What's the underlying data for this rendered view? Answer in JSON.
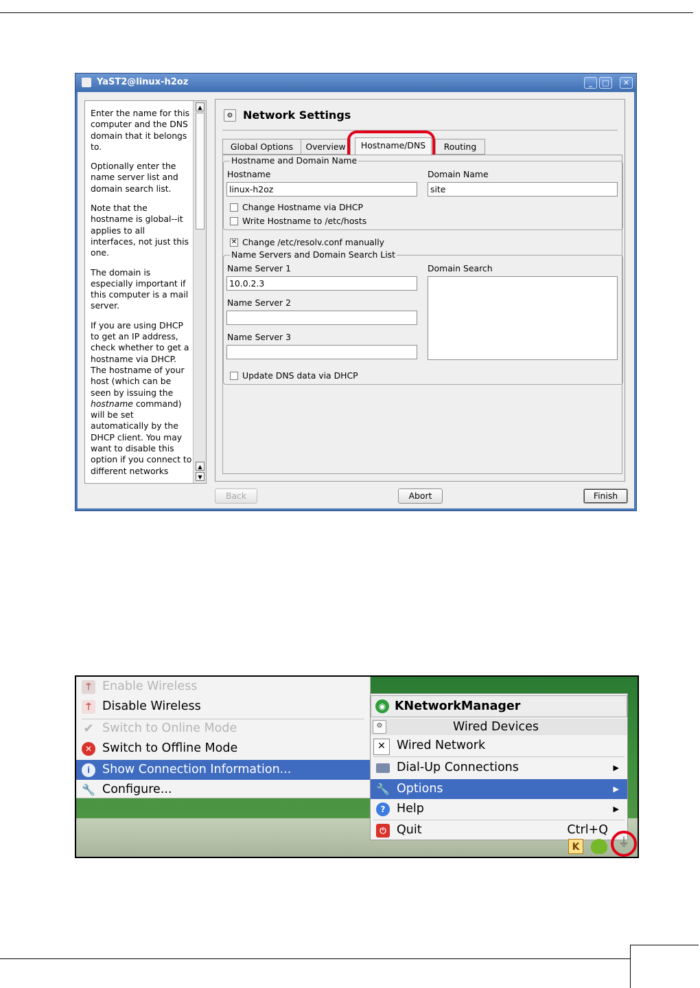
{
  "yast": {
    "title": "YaST2@linux-h2oz",
    "help_paragraphs": [
      "Enter the name for this computer and the DNS domain that it belongs to.",
      "Optionally enter the name server list and domain search list.",
      "Note that the hostname is global--it applies to all interfaces, not just this one.",
      "The domain is especially important if this computer is a mail server."
    ],
    "help_dhcp": {
      "before": "If you are using DHCP to get an IP address, check whether to get a hostname via DHCP. The hostname of your host (which can be seen by issuing the ",
      "em": "hostname",
      "after": " command) will be set automatically by the DHCP client. You may want to disable this option if you connect to different networks"
    },
    "page_title": "Network Settings",
    "tabs": [
      "Global Options",
      "Overview",
      "Hostname/DNS",
      "Routing"
    ],
    "group_hostname": "Hostname and Domain Name",
    "hostname_label": "Hostname",
    "hostname_value": "linux-h2oz",
    "domain_label": "Domain Name",
    "domain_value": "site",
    "cb_change_hostname": "Change Hostname via DHCP",
    "cb_write_hostname": "Write Hostname to /etc/hosts",
    "cb_resolv": "Change /etc/resolv.conf manually",
    "group_ns": "Name Servers and Domain Search List",
    "ns1_label": "Name Server 1",
    "ns1_value": "10.0.2.3",
    "ns2_label": "Name Server 2",
    "ns3_label": "Name Server 3",
    "domain_search_label": "Domain Search",
    "cb_update_dns": "Update DNS data via DHCP",
    "btn_back": "Back",
    "btn_abort": "Abort",
    "btn_finish": "Finish"
  },
  "knm": {
    "left_menu": [
      {
        "label": "Enable Wireless",
        "state": "disabled",
        "icon": "antenna-icon"
      },
      {
        "label": "Disable Wireless",
        "state": "normal",
        "icon": "antenna-icon"
      },
      {
        "label": "Switch to Online Mode",
        "state": "disabled",
        "icon": "checkmark-icon"
      },
      {
        "label": "Switch to Offline Mode",
        "state": "normal",
        "icon": "stop-icon"
      },
      {
        "label": "Show Connection Information...",
        "state": "selected",
        "icon": "info-icon"
      },
      {
        "label": "Configure...",
        "state": "normal",
        "icon": "wrench-icon"
      }
    ],
    "app_title": "KNetworkManager",
    "section_title": "Wired Devices",
    "right_menu": {
      "wired_network": "Wired Network",
      "dialup": "Dial-Up Connections",
      "options": "Options",
      "help": "Help",
      "quit": "Quit",
      "quit_shortcut": "Ctrl+Q"
    },
    "tray_k": "K"
  },
  "colors": {
    "highlight": "#3f6cc1",
    "annotation_red": "#e2001a",
    "titlebar_blue": "#4b79b9"
  }
}
